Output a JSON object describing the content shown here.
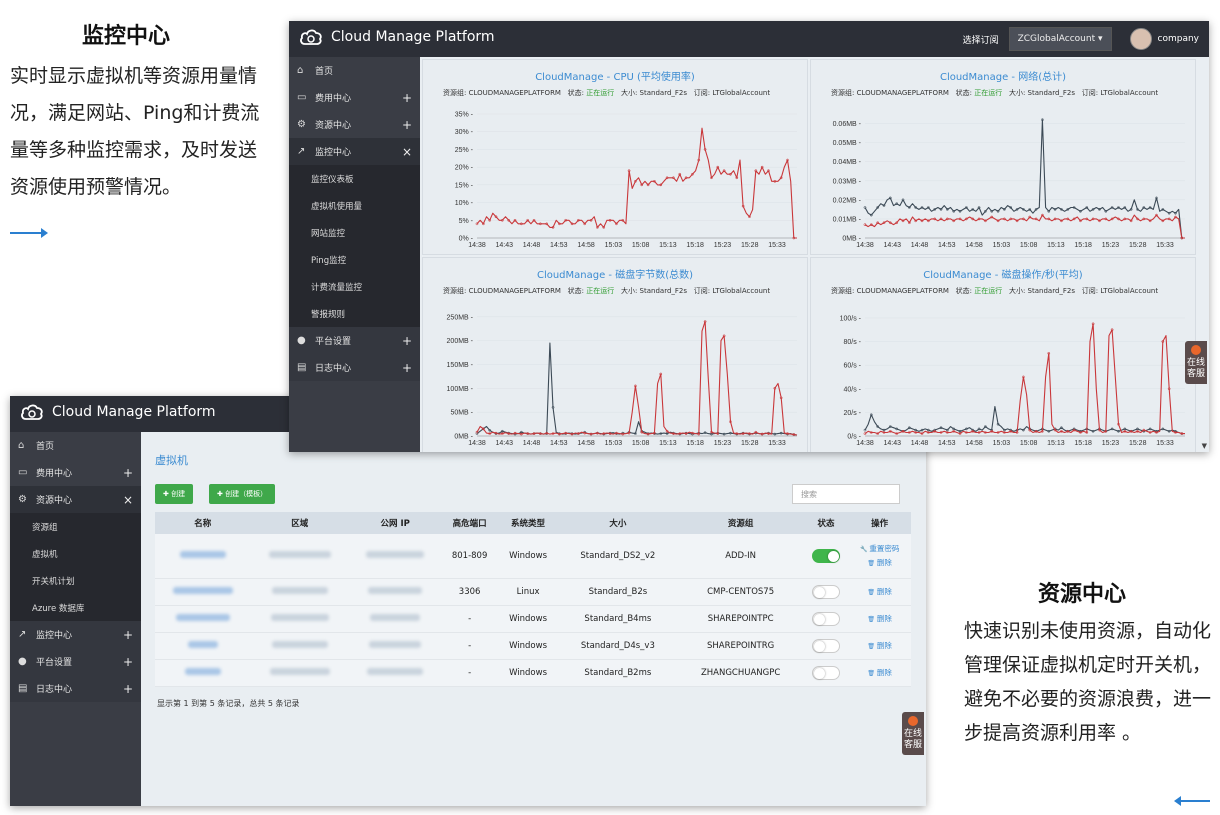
{
  "left": {
    "title": "监控中心",
    "desc": "实时显示虚拟机等资源用量情况，满足网站、Ping和计费流量等多种监控需求，及时发送资源使用预警情况。"
  },
  "right": {
    "title": "资源中心",
    "desc": "快速识别未使用资源，自动化管理保证虚拟机定时开关机，避免不必要的资源浪费，进一步提高资源利用率 。"
  },
  "brand": "Cloud Manage Platform",
  "monitor": {
    "select_label": "选择订阅",
    "account": "ZCGlobalAccount",
    "user": "company",
    "sidebar": [
      {
        "label": "首页",
        "icon": "home-icon",
        "glyph": "⌂",
        "toggle": ""
      },
      {
        "label": "费用中心",
        "icon": "card-icon",
        "glyph": "▭",
        "toggle": "+"
      },
      {
        "label": "资源中心",
        "icon": "gear-icon",
        "glyph": "⚙",
        "toggle": "+"
      },
      {
        "label": "监控中心",
        "icon": "chart-icon",
        "glyph": "↗",
        "toggle": "×"
      }
    ],
    "sub": [
      "监控仪表板",
      "虚拟机使用量",
      "网站监控",
      "Ping监控",
      "计费流量监控",
      "警报规则"
    ],
    "sidebar_bottom": [
      {
        "label": "平台设置",
        "icon": "user-icon",
        "glyph": "●",
        "toggle": "+"
      },
      {
        "label": "日志中心",
        "icon": "log-icon",
        "glyph": "▤",
        "toggle": "+"
      }
    ],
    "meta": {
      "group_label": "资源组: ",
      "group": "CLOUDMANAGEPLATFORM",
      "status_label": "状态: ",
      "status": "正在运行",
      "size_label": "大小: ",
      "size": "Standard_F2s",
      "sub_label": "订阅: ",
      "subscription": "LTGlobalAccount"
    },
    "online": "在线客服"
  },
  "chart_data": [
    {
      "type": "line",
      "title": "CloudManage - CPU (平均使用率)",
      "x": [
        "14:38",
        "14:43",
        "14:48",
        "14:53",
        "14:58",
        "15:03",
        "15:08",
        "15:13",
        "15:18",
        "15:23",
        "15:28",
        "15:33"
      ],
      "yticks": [
        "0%",
        "5%",
        "10%",
        "15%",
        "20%",
        "25%",
        "30%",
        "35%"
      ],
      "ylim": [
        0,
        35
      ],
      "series": [
        {
          "color": "#c9373a",
          "values": [
            4,
            5,
            4,
            6,
            5,
            7,
            6,
            5,
            5,
            6,
            5,
            4,
            5,
            4,
            4,
            4,
            5,
            4,
            5,
            4,
            4,
            4,
            4,
            3,
            3,
            5,
            4,
            4,
            5,
            5,
            4,
            4,
            5,
            5,
            4,
            5,
            5,
            6,
            3,
            4,
            3,
            5,
            5,
            5,
            4,
            5,
            5,
            4,
            19,
            14,
            16,
            17,
            15,
            16,
            15,
            16,
            16,
            15,
            15,
            16,
            17,
            17,
            17,
            16,
            18,
            16,
            17,
            17,
            18,
            19,
            22,
            31,
            25,
            22,
            17,
            18,
            20,
            18,
            19,
            18,
            18,
            19,
            17,
            22,
            9,
            7,
            6,
            8,
            19,
            18,
            20,
            18,
            19,
            16,
            16,
            16,
            17,
            20,
            22,
            16,
            0,
            0
          ]
        }
      ]
    },
    {
      "type": "line",
      "title": "CloudManage - 网络(总计)",
      "x": [
        "14:38",
        "14:43",
        "14:48",
        "14:53",
        "14:58",
        "15:03",
        "15:08",
        "15:13",
        "15:18",
        "15:23",
        "15:28",
        "15:33"
      ],
      "yticks": [
        "0MB",
        "0.01MB",
        "0.02MB",
        "0.03MB",
        "0.04MB",
        "0.05MB",
        "0.06MB"
      ],
      "ylim": [
        0,
        0.065
      ],
      "series": [
        {
          "color": "#3c4a56",
          "values": [
            0.016,
            0.013,
            0.012,
            0.014,
            0.016,
            0.018,
            0.017,
            0.02,
            0.021,
            0.017,
            0.018,
            0.017,
            0.02,
            0.017,
            0.016,
            0.018,
            0.016,
            0.015,
            0.016,
            0.015,
            0.016,
            0.014,
            0.015,
            0.016,
            0.015,
            0.017,
            0.015,
            0.016,
            0.014,
            0.015,
            0.014,
            0.015,
            0.016,
            0.014,
            0.015,
            0.014,
            0.016,
            0.012,
            0.014,
            0.016,
            0.014,
            0.015,
            0.014,
            0.016,
            0.015,
            0.017,
            0.016,
            0.014,
            0.015,
            0.016,
            0.015,
            0.014,
            0.015,
            0.013,
            0.015,
            0.016,
            0.062,
            0.016,
            0.014,
            0.016,
            0.015,
            0.016,
            0.015,
            0.014,
            0.015,
            0.016,
            0.016,
            0.015,
            0.014,
            0.015,
            0.016,
            0.014,
            0.015,
            0.016,
            0.015,
            0.016,
            0.014,
            0.015,
            0.016,
            0.015,
            0.016,
            0.015,
            0.016,
            0.014,
            0.015,
            0.02,
            0.015,
            0.014,
            0.016,
            0.015,
            0.016,
            0.015,
            0.021,
            0.014,
            0.015,
            0.014,
            0.013,
            0.014,
            0.013,
            0.015,
            0.0,
            0.0
          ]
        },
        {
          "color": "#c9373a",
          "values": [
            0.007,
            0.006,
            0.007,
            0.006,
            0.008,
            0.007,
            0.008,
            0.009,
            0.008,
            0.007,
            0.008,
            0.01,
            0.009,
            0.01,
            0.008,
            0.011,
            0.009,
            0.01,
            0.009,
            0.01,
            0.009,
            0.01,
            0.01,
            0.009,
            0.01,
            0.009,
            0.01,
            0.01,
            0.009,
            0.01,
            0.01,
            0.009,
            0.01,
            0.011,
            0.01,
            0.009,
            0.01,
            0.01,
            0.009,
            0.01,
            0.011,
            0.01,
            0.009,
            0.01,
            0.01,
            0.009,
            0.01,
            0.01,
            0.009,
            0.01,
            0.01,
            0.009,
            0.011,
            0.01,
            0.01,
            0.009,
            0.012,
            0.01,
            0.01,
            0.009,
            0.01,
            0.01,
            0.009,
            0.01,
            0.01,
            0.009,
            0.01,
            0.011,
            0.009,
            0.01,
            0.01,
            0.009,
            0.01,
            0.01,
            0.009,
            0.01,
            0.01,
            0.009,
            0.01,
            0.011,
            0.01,
            0.009,
            0.01,
            0.01,
            0.009,
            0.012,
            0.01,
            0.009,
            0.01,
            0.01,
            0.009,
            0.01,
            0.012,
            0.01,
            0.009,
            0.01,
            0.01,
            0.009,
            0.011,
            0.01,
            0.0,
            0.0
          ]
        }
      ]
    },
    {
      "type": "line",
      "title": "CloudManage - 磁盘字节数(总数)",
      "x": [
        "14:38",
        "14:43",
        "14:48",
        "14:53",
        "14:58",
        "15:03",
        "15:08",
        "15:13",
        "15:18",
        "15:23",
        "15:28",
        "15:33"
      ],
      "yticks": [
        "0MB",
        "50MB",
        "100MB",
        "150MB",
        "200MB",
        "250MB"
      ],
      "ylim": [
        0,
        260
      ],
      "series": [
        {
          "color": "#3c4a56",
          "values": [
            5,
            10,
            15,
            20,
            12,
            8,
            5,
            6,
            10,
            8,
            6,
            5,
            4,
            5,
            8,
            6,
            5,
            4,
            5,
            6,
            5,
            4,
            5,
            195,
            60,
            8,
            5,
            4,
            5,
            6,
            5,
            4,
            5,
            6,
            8,
            5,
            4,
            5,
            6,
            5,
            4,
            5,
            6,
            7,
            5,
            4,
            6,
            5,
            8,
            6,
            5,
            30,
            10,
            8,
            5,
            6,
            5,
            4,
            5,
            6,
            5,
            8,
            6,
            5,
            4,
            5,
            6,
            5,
            4,
            5,
            6,
            5,
            7,
            5,
            4,
            5,
            6,
            5,
            4,
            5,
            6,
            5,
            4,
            5,
            6,
            5,
            4,
            5,
            6,
            5,
            4,
            5,
            6,
            5,
            4,
            5,
            6,
            5,
            4,
            5,
            3,
            2
          ]
        },
        {
          "color": "#c9373a",
          "values": [
            8,
            20,
            15,
            6,
            5,
            8,
            6,
            4,
            5,
            7,
            5,
            4,
            6,
            5,
            4,
            6,
            5,
            4,
            5,
            6,
            5,
            4,
            6,
            4,
            5,
            6,
            4,
            5,
            6,
            5,
            4,
            6,
            5,
            8,
            6,
            5,
            4,
            5,
            6,
            4,
            5,
            6,
            5,
            4,
            6,
            5,
            4,
            5,
            6,
            50,
            105,
            60,
            8,
            5,
            4,
            5,
            6,
            110,
            130,
            20,
            10,
            6,
            5,
            4,
            5,
            6,
            5,
            8,
            6,
            5,
            4,
            220,
            240,
            120,
            8,
            6,
            5,
            200,
            210,
            130,
            30,
            6,
            5,
            4,
            5,
            6,
            5,
            4,
            8,
            5,
            4,
            6,
            5,
            4,
            100,
            110,
            80,
            6,
            5,
            4,
            3,
            2
          ]
        }
      ]
    },
    {
      "type": "line",
      "title": "CloudManage - 磁盘操作/秒(平均)",
      "x": [
        "14:38",
        "14:43",
        "14:48",
        "14:53",
        "14:58",
        "15:03",
        "15:08",
        "15:13",
        "15:18",
        "15:23",
        "15:28",
        "15:33"
      ],
      "yticks": [
        "0/s",
        "20/s",
        "40/s",
        "60/s",
        "80/s",
        "100/s"
      ],
      "ylim": [
        0,
        105
      ],
      "series": [
        {
          "color": "#3c4a56",
          "values": [
            5,
            10,
            18,
            12,
            8,
            6,
            5,
            6,
            8,
            7,
            6,
            5,
            4,
            5,
            7,
            6,
            5,
            4,
            5,
            6,
            5,
            4,
            5,
            6,
            7,
            6,
            5,
            8,
            6,
            5,
            4,
            5,
            6,
            7,
            5,
            4,
            6,
            5,
            8,
            6,
            5,
            25,
            10,
            8,
            5,
            6,
            5,
            4,
            5,
            6,
            5,
            8,
            6,
            5,
            4,
            5,
            6,
            5,
            4,
            5,
            6,
            5,
            7,
            5,
            4,
            5,
            6,
            5,
            4,
            5,
            6,
            5,
            4,
            5,
            6,
            5,
            4,
            5,
            6,
            5,
            4,
            5,
            6,
            5,
            4,
            5,
            6,
            5,
            4,
            5,
            6,
            5,
            4,
            5,
            6,
            5,
            4,
            5,
            4,
            3,
            2,
            2
          ]
        },
        {
          "color": "#c9373a",
          "values": [
            2,
            4,
            3,
            3,
            2,
            4,
            3,
            3,
            4,
            3,
            2,
            3,
            4,
            3,
            3,
            4,
            3,
            3,
            2,
            4,
            3,
            3,
            4,
            3,
            3,
            4,
            3,
            3,
            4,
            3,
            2,
            4,
            3,
            3,
            4,
            3,
            3,
            4,
            3,
            3,
            4,
            3,
            3,
            4,
            3,
            3,
            4,
            3,
            3,
            30,
            50,
            35,
            5,
            3,
            4,
            3,
            4,
            50,
            70,
            10,
            5,
            3,
            4,
            3,
            4,
            3,
            5,
            4,
            3,
            4,
            3,
            80,
            95,
            40,
            5,
            3,
            4,
            85,
            90,
            50,
            10,
            3,
            4,
            3,
            4,
            3,
            4,
            3,
            5,
            4,
            3,
            4,
            3,
            4,
            80,
            85,
            40,
            4,
            3,
            3,
            2,
            2
          ]
        }
      ]
    }
  ],
  "resource": {
    "sidebar": [
      {
        "label": "首页",
        "icon": "home-icon",
        "glyph": "⌂",
        "toggle": ""
      },
      {
        "label": "费用中心",
        "icon": "card-icon",
        "glyph": "▭",
        "toggle": "+"
      },
      {
        "label": "资源中心",
        "icon": "gear-icon",
        "glyph": "⚙",
        "toggle": "×"
      }
    ],
    "sub": [
      "资源组",
      "虚拟机",
      "开关机计划",
      "Azure 数据库"
    ],
    "sidebar_bottom": [
      {
        "label": "监控中心",
        "icon": "chart-icon",
        "glyph": "↗",
        "toggle": "+"
      },
      {
        "label": "平台设置",
        "icon": "user-icon",
        "glyph": "●",
        "toggle": "+"
      },
      {
        "label": "日志中心",
        "icon": "log-icon",
        "glyph": "▤",
        "toggle": "+"
      }
    ],
    "page_title": "虚拟机",
    "btn_create": "创建",
    "btn_create_tpl": "创建（模板）",
    "search_placeholder": "搜索",
    "columns": [
      "名称",
      "区域",
      "公网 IP",
      "高危端口",
      "系统类型",
      "大小",
      "资源组",
      "状态",
      "操作"
    ],
    "rows": [
      {
        "port": "801-809",
        "os": "Windows",
        "size": "Standard_DS2_v2",
        "group": "ADD-IN",
        "on": true,
        "actions": [
          "重置密码",
          "删除"
        ]
      },
      {
        "port": "3306",
        "os": "Linux",
        "size": "Standard_B2s",
        "group": "CMP-CENTOS75",
        "on": false,
        "actions": [
          "删除"
        ]
      },
      {
        "port": "-",
        "os": "Windows",
        "size": "Standard_B4ms",
        "group": "SHAREPOINTPC",
        "on": false,
        "actions": [
          "删除"
        ]
      },
      {
        "port": "-",
        "os": "Windows",
        "size": "Standard_D4s_v3",
        "group": "SHAREPOINTRG",
        "on": false,
        "actions": [
          "删除"
        ]
      },
      {
        "port": "-",
        "os": "Windows",
        "size": "Standard_B2ms",
        "group": "ZHANGCHUANGPC",
        "on": false,
        "actions": [
          "删除"
        ]
      }
    ],
    "footer": "显示第 1 到第 5 条记录，总共 5 条记录",
    "online": "在线客服"
  }
}
